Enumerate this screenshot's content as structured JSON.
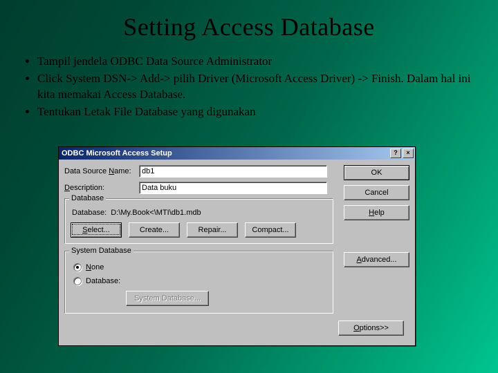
{
  "slide": {
    "title": "Setting Access Database",
    "bullets": [
      "Tampil jendela ODBC Data Source Administrator",
      "Click System DSN-> Add-> pilih Driver (Microsoft  Access Driver) -> Finish. Dalam hal ini kita memakai Access Database.",
      "Tentukan Letak File Database yang digunakan"
    ]
  },
  "dialog": {
    "title": "ODBC Microsoft Access Setup",
    "help_glyph": "?",
    "close_glyph": "×",
    "fields": {
      "dsn_label_pre": "Data Source ",
      "dsn_label_u": "N",
      "dsn_label_post": "ame:",
      "dsn_value": "db1",
      "desc_label_u": "D",
      "desc_label_post": "escription:",
      "desc_value": "Data buku"
    },
    "buttons": {
      "ok": "OK",
      "cancel": "Cancel",
      "help": "Help",
      "advanced": "Advanced...",
      "options": "Options>>"
    },
    "database_group": {
      "legend": "Database",
      "path_label": "Database:",
      "path_value": "D:\\My.Book<\\MTI\\db1.mdb",
      "select": "Select...",
      "create": "Create...",
      "repair": "Repair...",
      "compact": "Compact..."
    },
    "sysdb_group": {
      "legend": "System Database",
      "none_u": "N",
      "none_post": "one",
      "database_label": "Database:",
      "sysdb_btn": "System Database..."
    }
  }
}
